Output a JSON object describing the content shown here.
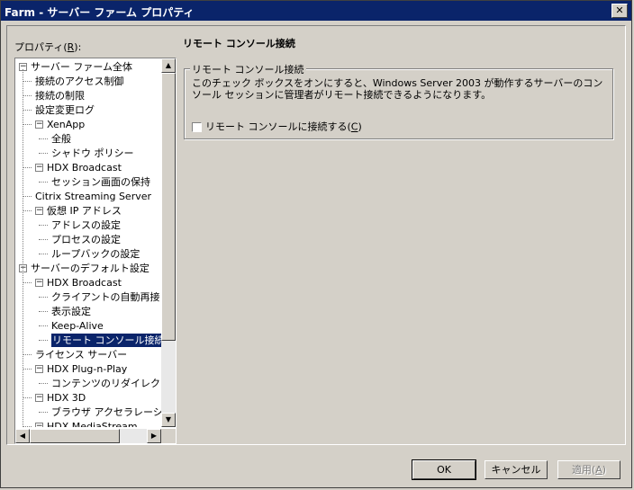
{
  "window": {
    "title": "Farm - サーバー ファーム プロパティ",
    "close_glyph": "✕"
  },
  "left_panel": {
    "label_prefix": "プロパティ(",
    "label_accel": "R",
    "label_suffix": "):"
  },
  "tree": [
    {
      "text": "サーバー ファーム全体",
      "level": 0,
      "expander": "−"
    },
    {
      "text": "接続のアクセス制御",
      "level": 1
    },
    {
      "text": "接続の制限",
      "level": 1
    },
    {
      "text": "設定変更ログ",
      "level": 1
    },
    {
      "text": "XenApp",
      "level": 1,
      "expander": "−"
    },
    {
      "text": "全般",
      "level": 2
    },
    {
      "text": "シャドウ ポリシー",
      "level": 2
    },
    {
      "text": "HDX Broadcast",
      "level": 1,
      "expander": "−"
    },
    {
      "text": "セッション画面の保持",
      "level": 2
    },
    {
      "text": "Citrix Streaming Server",
      "level": 1
    },
    {
      "text": "仮想 IP アドレス",
      "level": 1,
      "expander": "−"
    },
    {
      "text": "アドレスの設定",
      "level": 2
    },
    {
      "text": "プロセスの設定",
      "level": 2
    },
    {
      "text": "ループバックの設定",
      "level": 2
    },
    {
      "text": "サーバーのデフォルト設定",
      "level": 0,
      "expander": "−"
    },
    {
      "text": "HDX Broadcast",
      "level": 1,
      "expander": "−"
    },
    {
      "text": "クライアントの自動再接",
      "level": 2
    },
    {
      "text": "表示設定",
      "level": 2
    },
    {
      "text": "Keep-Alive",
      "level": 2
    },
    {
      "text": "リモート コンソール接続",
      "level": 2,
      "selected": true
    },
    {
      "text": "ライセンス サーバー",
      "level": 1
    },
    {
      "text": "HDX Plug-n-Play",
      "level": 1,
      "expander": "−"
    },
    {
      "text": "コンテンツのリダイレクト",
      "level": 2
    },
    {
      "text": "HDX 3D",
      "level": 1,
      "expander": "−"
    },
    {
      "text": "ブラウザ アクセラレーシ",
      "level": 2
    },
    {
      "text": "HDX MediaStream",
      "level": 1,
      "expander": "−"
    }
  ],
  "scroll_glyphs": {
    "up": "▲",
    "down": "▼",
    "left": "◀",
    "right": "▶"
  },
  "page": {
    "title": "リモート コンソール接続",
    "group_label": "リモート コンソール接続",
    "description": "このチェック ボックスをオンにすると、Windows Server 2003 が動作するサーバーのコンソール セッションに管理者がリモート接続できるようになります。",
    "checkbox_prefix": "リモート コンソールに接続する(",
    "checkbox_accel": "C",
    "checkbox_suffix": ")",
    "checkbox_checked": false
  },
  "buttons": {
    "ok": "OK",
    "cancel": "キャンセル",
    "apply_prefix": "適用(",
    "apply_accel": "A",
    "apply_suffix": ")"
  }
}
